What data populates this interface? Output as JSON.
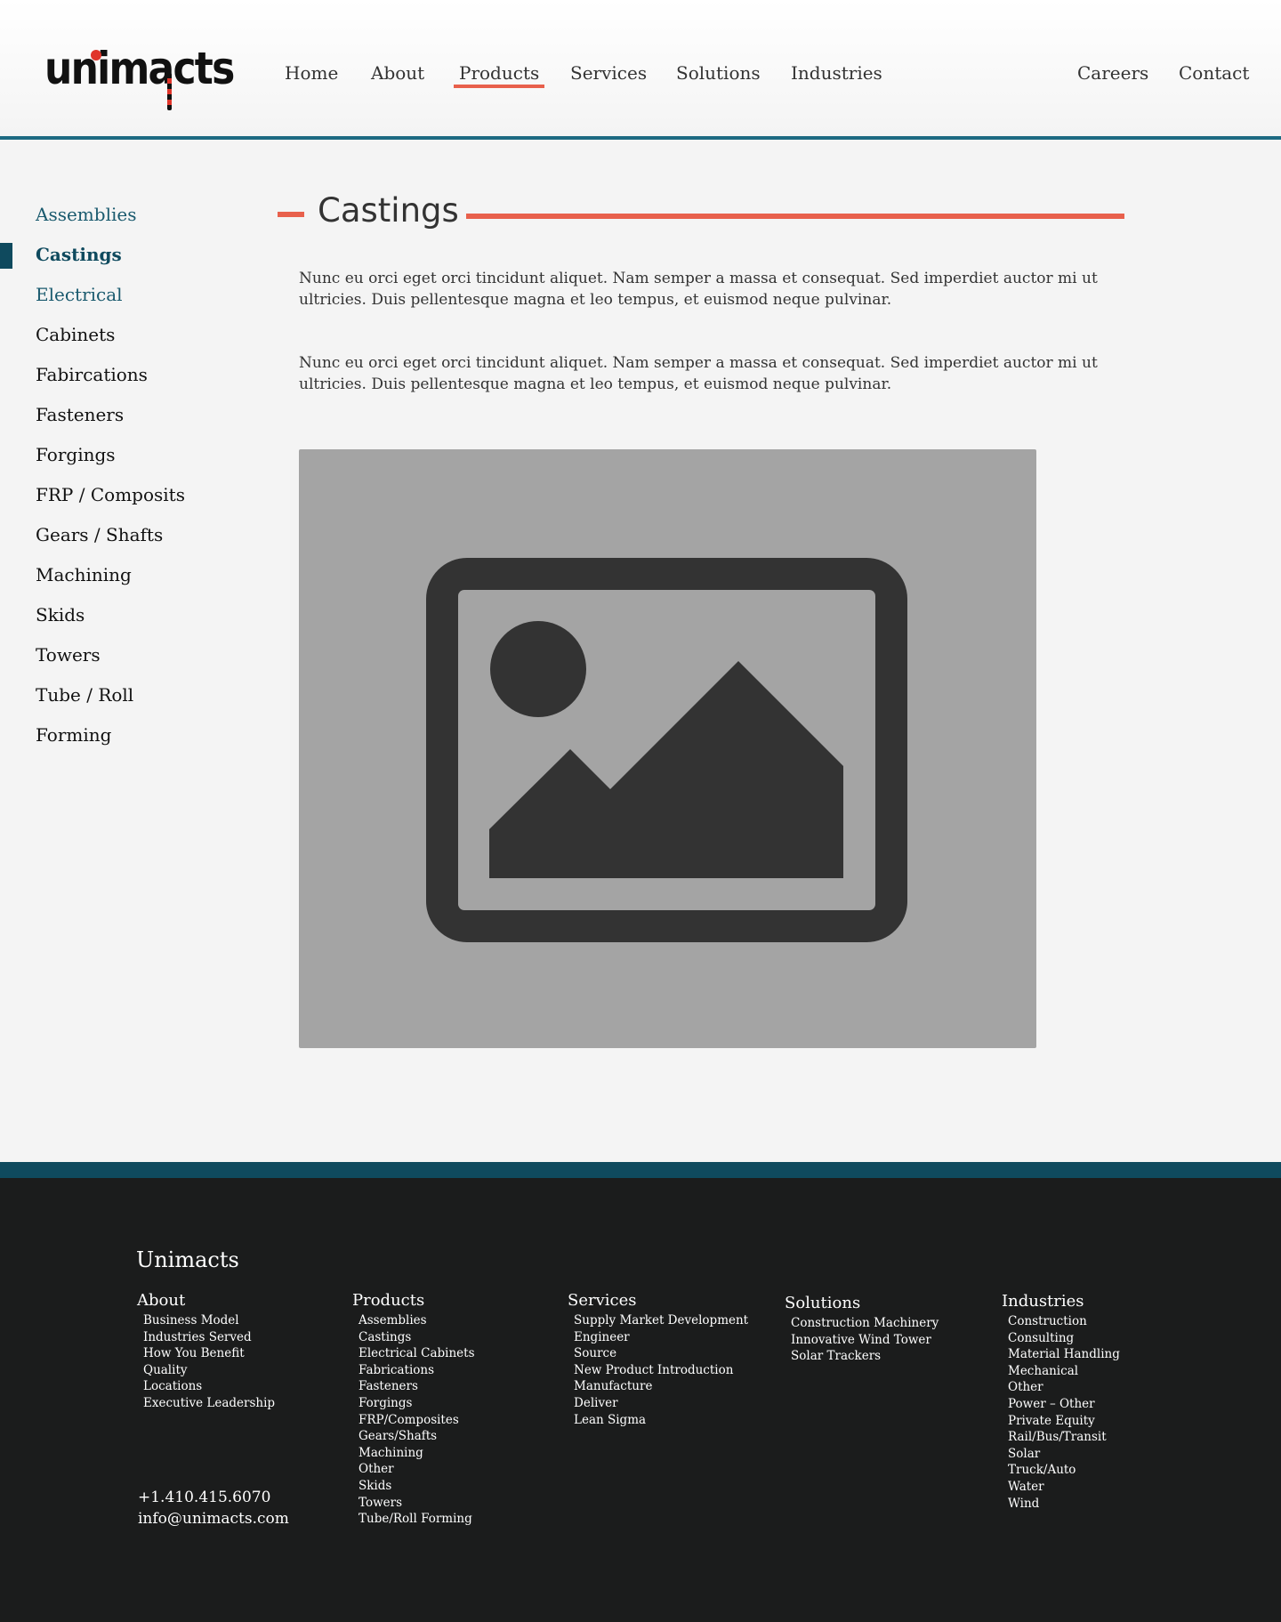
{
  "header": {
    "logo_text": "unimacts",
    "nav": [
      {
        "label": "Home"
      },
      {
        "label": "About"
      },
      {
        "label": "Products",
        "active": true
      },
      {
        "label": "Services"
      },
      {
        "label": "Solutions"
      },
      {
        "label": "Industries"
      },
      {
        "label": "Careers"
      },
      {
        "label": "Contact"
      }
    ]
  },
  "sidebar": {
    "items": [
      {
        "label": "Assemblies"
      },
      {
        "label": "Castings",
        "active": true
      },
      {
        "label": "Electrical"
      },
      {
        "label": "Cabinets"
      },
      {
        "label": "Fabircations"
      },
      {
        "label": "Fasteners"
      },
      {
        "label": "Forgings"
      },
      {
        "label": "FRP / Composits"
      },
      {
        "label": "Gears / Shafts"
      },
      {
        "label": "Machining"
      },
      {
        "label": "Skids"
      },
      {
        "label": "Towers"
      },
      {
        "label": "Tube / Roll"
      },
      {
        "label": "Forming"
      }
    ]
  },
  "main": {
    "title": "Castings",
    "paragraphs": [
      "Nunc eu orci eget orci tincidunt aliquet. Nam semper a massa et consequat. Sed imperdiet auctor mi ut ultricies. Duis pellentesque magna et leo tempus, et euismod neque pulvinar.",
      "Nunc eu orci eget orci tincidunt aliquet. Nam semper a massa et consequat. Sed imperdiet auctor mi ut ultricies. Duis pellentesque magna et leo tempus, et euismod neque pulvinar."
    ],
    "image_icon": "image-placeholder-icon"
  },
  "footer": {
    "brand": "Unimacts",
    "columns": [
      {
        "heading": "About",
        "items": [
          "Business Model",
          "Industries Served",
          "How You Benefit",
          "Quality",
          "Locations",
          "Executive Leadership"
        ]
      },
      {
        "heading": "Products",
        "items": [
          "Assemblies",
          "Castings",
          "Electrical Cabinets",
          "Fabrications",
          "Fasteners",
          "Forgings",
          "FRP/Composites",
          "Gears/Shafts",
          "Machining",
          "Other",
          "Skids",
          "Towers",
          "Tube/Roll Forming"
        ]
      },
      {
        "heading": "Services",
        "items": [
          "Supply Market Development",
          "Engineer",
          "Source",
          "New Product Introduction",
          "Manufacture",
          "Deliver",
          "Lean Sigma"
        ]
      },
      {
        "heading": "Solutions",
        "items": [
          "Construction Machinery",
          "Innovative Wind Tower",
          "Solar Trackers"
        ]
      },
      {
        "heading": "Industries",
        "items": [
          "Construction",
          "Consulting",
          "Material Handling",
          "Mechanical",
          "Other",
          "Power – Other",
          "Private Equity",
          "Rail/Bus/Transit",
          "Solar",
          "Truck/Auto",
          "Water",
          "Wind"
        ]
      }
    ],
    "phone": "+1.410.415.6070",
    "email": "info@unimacts.com"
  },
  "colors": {
    "accent": "#e8604c",
    "teal": "#1d6a82",
    "dark_teal": "#0f4a5e",
    "footer_bg": "#1b1c1c"
  }
}
